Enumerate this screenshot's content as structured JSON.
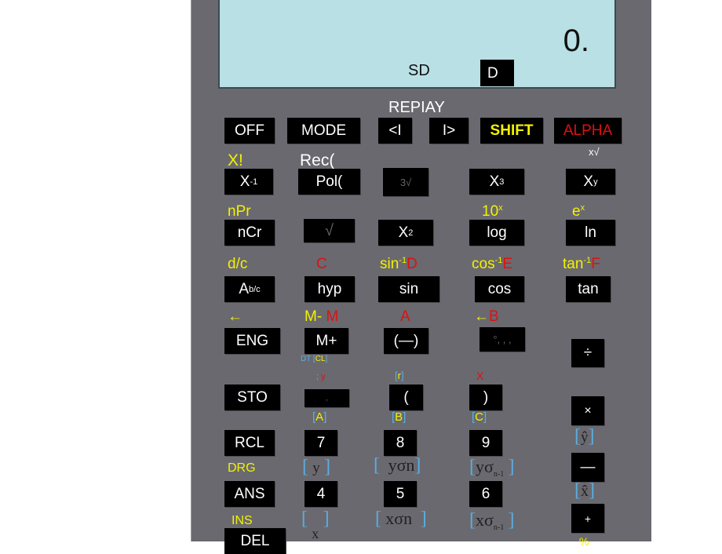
{
  "display": {
    "value": "0.",
    "mode_indicator": "SD",
    "angle_indicator": "D"
  },
  "top_label": "REPIAY",
  "row1": {
    "off": "OFF",
    "mode": "MODE",
    "left": "<I",
    "right": "I>",
    "shift": "SHIFT",
    "alpha": "ALPHA"
  },
  "row2": {
    "labels": {
      "fact": "X!",
      "rec": "Rec(",
      "xroot": "x√"
    },
    "keys": {
      "inv": "X",
      "inv_sup": "-1",
      "pol": "Pol(",
      "cuberoot": "3√",
      "cube": "X",
      "cube_sup": "3",
      "pow": "X",
      "pow_sup": "y"
    }
  },
  "row3": {
    "labels": {
      "npr": "nPr",
      "tenx": "10",
      "tenx_sup": "x",
      "ex": "e",
      "ex_sup": "x"
    },
    "keys": {
      "ncr": "nCr",
      "sqrt": "√",
      "sq": "X",
      "sq_sup": "2",
      "log": "log",
      "ln": "ln"
    }
  },
  "row4": {
    "labels": {
      "dc": "d/c",
      "c": "C",
      "asin": "sin",
      "asin_sup": "-1",
      "d": "D",
      "acos": "cos",
      "acos_sup": "-1",
      "e": "E",
      "atan": "tan",
      "atan_sup": "-1",
      "f": "F"
    },
    "keys": {
      "abc": "A",
      "abc_sup": "b/c",
      "hyp": "hyp",
      "sin": "sin",
      "cos": "cos",
      "tan": "tan"
    }
  },
  "row5": {
    "labels": {
      "back": "←",
      "mminus": "M-",
      "m": "M",
      "a": "A",
      "back2": "←",
      "b": "B",
      "dt": "DT",
      "cl": "CL"
    },
    "keys": {
      "eng": "ENG",
      "mplus": "M+",
      "neg": "(—)",
      "dms": "°, , ,",
      "div": "÷"
    }
  },
  "row6": {
    "labels": {
      "semi": ";",
      "yvar": "y",
      "r": "r",
      "x": "X",
      "a_bracket": "A",
      "b_bracket": "B",
      "c_bracket": "C"
    },
    "keys": {
      "sto": "STO",
      "comma": ",",
      "lparen": "(",
      "rparen": ")",
      "mul": "×"
    }
  },
  "row7": {
    "labels": {
      "yhat": "ŷ"
    },
    "keys": {
      "rcl": "RCL",
      "seven": "7",
      "eight": "8",
      "nine": "9",
      "minus": "—"
    }
  },
  "row8": {
    "labels": {
      "drg": "DRG",
      "ybar": "y",
      "yon": "yσn",
      "yon1": "yσ",
      "yon1_sub": "n-1",
      "xhat": "x̂"
    },
    "keys": {
      "ans": "ANS",
      "four": "4",
      "five": "5",
      "six": "6",
      "plus": "+"
    }
  },
  "row9": {
    "labels": {
      "ins": "INS",
      "xbar": "x",
      "xon": "xσn",
      "xon1": "xσ",
      "xon1_sub": "n-1",
      "pct": "%"
    },
    "keys": {
      "del": "DEL"
    }
  }
}
